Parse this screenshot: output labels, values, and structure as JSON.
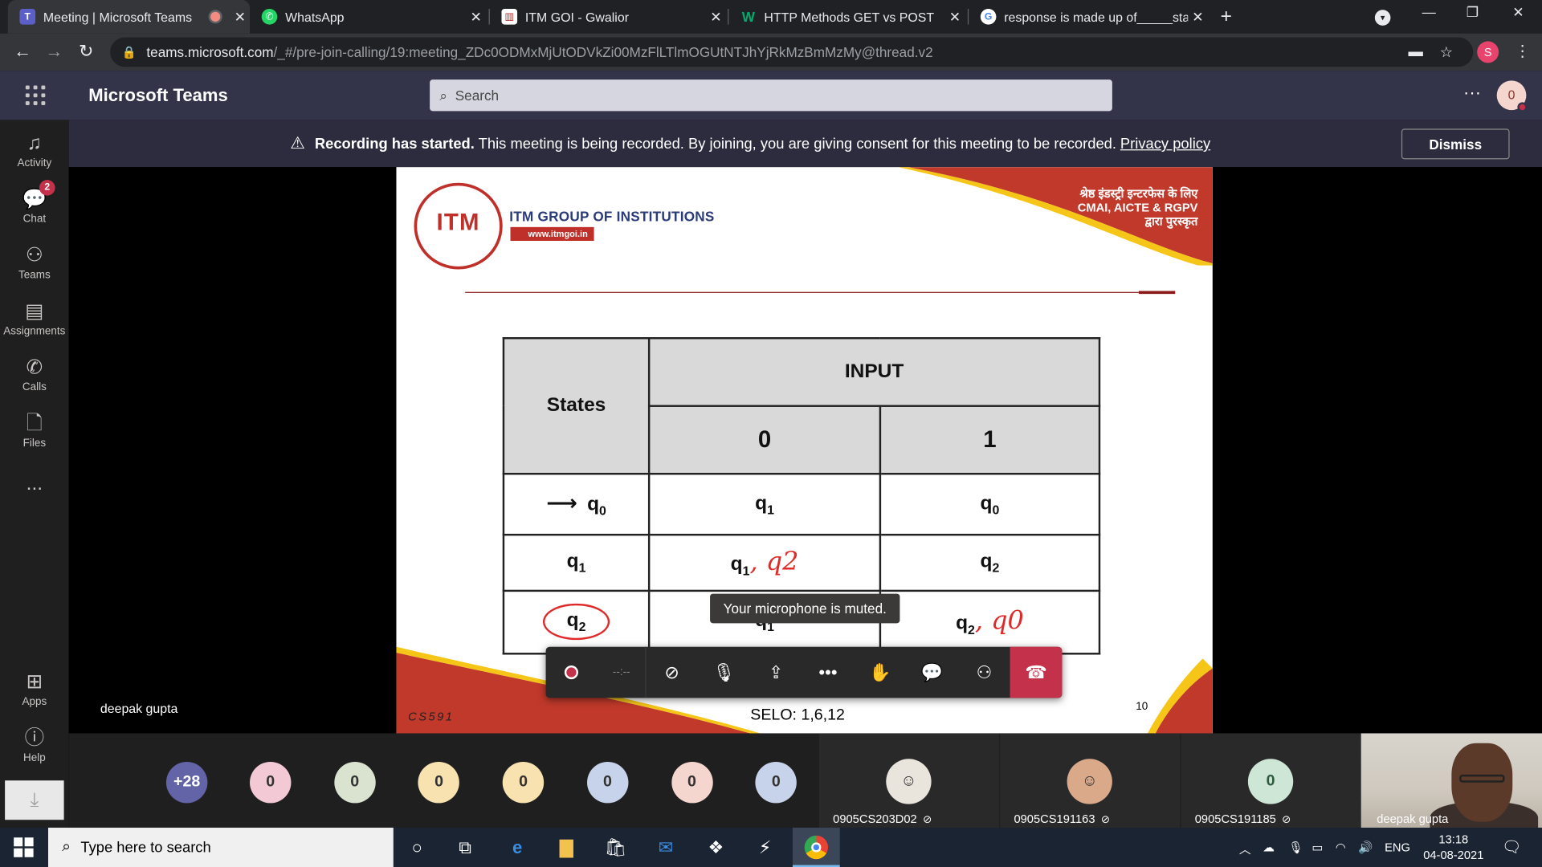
{
  "browser": {
    "tabs": [
      {
        "title": "Meeting | Microsoft Teams",
        "icon": "teams-icon"
      },
      {
        "title": "WhatsApp",
        "icon": "whatsapp-icon"
      },
      {
        "title": "ITM GOI - Gwalior",
        "icon": "itm-icon"
      },
      {
        "title": "HTTP Methods GET vs POST",
        "icon": "w3schools-icon"
      },
      {
        "title": "response is made up of_____sta",
        "icon": "google-icon"
      }
    ],
    "url_host": "teams.microsoft.com",
    "url_path": "/_#/pre-join-calling/19:meeting_ZDc0ODMxMjUtODVkZi00MzFlLTlmOGUtNTJhYjRkMzBmMzMy@thread.v2",
    "profile_initial": "S"
  },
  "teams": {
    "app_name": "Microsoft Teams",
    "search_placeholder": "Search",
    "user_initial": "0",
    "rail": [
      {
        "label": "Activity",
        "icon": "bell-icon"
      },
      {
        "label": "Chat",
        "icon": "chat-icon",
        "badge": "2"
      },
      {
        "label": "Teams",
        "icon": "teams-icon"
      },
      {
        "label": "Assignments",
        "icon": "assignments-icon"
      },
      {
        "label": "Calls",
        "icon": "phone-icon"
      },
      {
        "label": "Files",
        "icon": "file-icon"
      },
      {
        "label": "...",
        "icon": "more-icon"
      },
      {
        "label": "Apps",
        "icon": "apps-icon"
      },
      {
        "label": "Help",
        "icon": "help-icon"
      }
    ]
  },
  "banner": {
    "bold": "Recording has started.",
    "text": "This meeting is being recorded. By joining, you are giving consent for this meeting to be recorded.",
    "link": "Privacy policy",
    "dismiss": "Dismiss"
  },
  "meeting": {
    "presenter_name": "deepak gupta",
    "tooltip": "Your microphone is muted.",
    "timer": "--:--"
  },
  "slide": {
    "logo_text": "ITM",
    "institution": "ITM GROUP OF INSTITUTIONS",
    "website": "www.itmgoi.in",
    "award_line1": "श्रेष्ठ इंडस्ट्री इन्टरफेस के लिए",
    "award_line2": "CMAI, AICTE & RGPV",
    "award_line3": "द्वारा पुरस्कृत",
    "footer_left": "CS591",
    "selo": "SELO: 1,6,12",
    "page_number": "10",
    "table": {
      "states_header": "States",
      "input_header": "INPUT",
      "inputs": [
        "0",
        "1"
      ],
      "rows": [
        {
          "state": "q",
          "state_sub": "0",
          "start": true,
          "c0": "q",
          "c0_sub": "1",
          "c0_ink": "",
          "c1": "q",
          "c1_sub": "0",
          "c1_ink": ""
        },
        {
          "state": "q",
          "state_sub": "1",
          "start": false,
          "c0": "q",
          "c0_sub": "1",
          "c0_ink": ", q2",
          "c1": "q",
          "c1_sub": "2",
          "c1_ink": ""
        },
        {
          "state": "q",
          "state_sub": "2",
          "start": false,
          "final": true,
          "c0": "q",
          "c0_sub": "1",
          "c0_ink": "",
          "c1": "q",
          "c1_sub": "2",
          "c1_ink": ", q0"
        }
      ]
    }
  },
  "participants": {
    "overflow": "+28",
    "bubbles": [
      {
        "label": "0",
        "color": "#f3c9d6"
      },
      {
        "label": "0",
        "color": "#d9e3d0"
      },
      {
        "label": "0",
        "color": "#f7e2b0"
      },
      {
        "label": "0",
        "color": "#f7e2b0"
      },
      {
        "label": "0",
        "color": "#c7d3ea"
      },
      {
        "label": "0",
        "color": "#f4d6cf"
      },
      {
        "label": "0",
        "color": "#c7d3ea"
      }
    ],
    "tiles": [
      {
        "name": "0905CS203D02",
        "face": "",
        "color": "#e9e4dc"
      },
      {
        "name": "0905CS191163",
        "face": "",
        "color": "#d9a98a"
      },
      {
        "name": "0905CS191185",
        "face": "0",
        "color": "#cde6d5"
      }
    ],
    "video_name": "deepak gupta"
  },
  "taskbar": {
    "search_placeholder": "Type here to search",
    "lang": "ENG",
    "time": "13:18",
    "date": "04-08-2021"
  },
  "colors": {
    "teams_header": "#33344a",
    "rail": "#201f1f",
    "hangup": "#c4314b",
    "slide_accent": "#c0302a"
  }
}
